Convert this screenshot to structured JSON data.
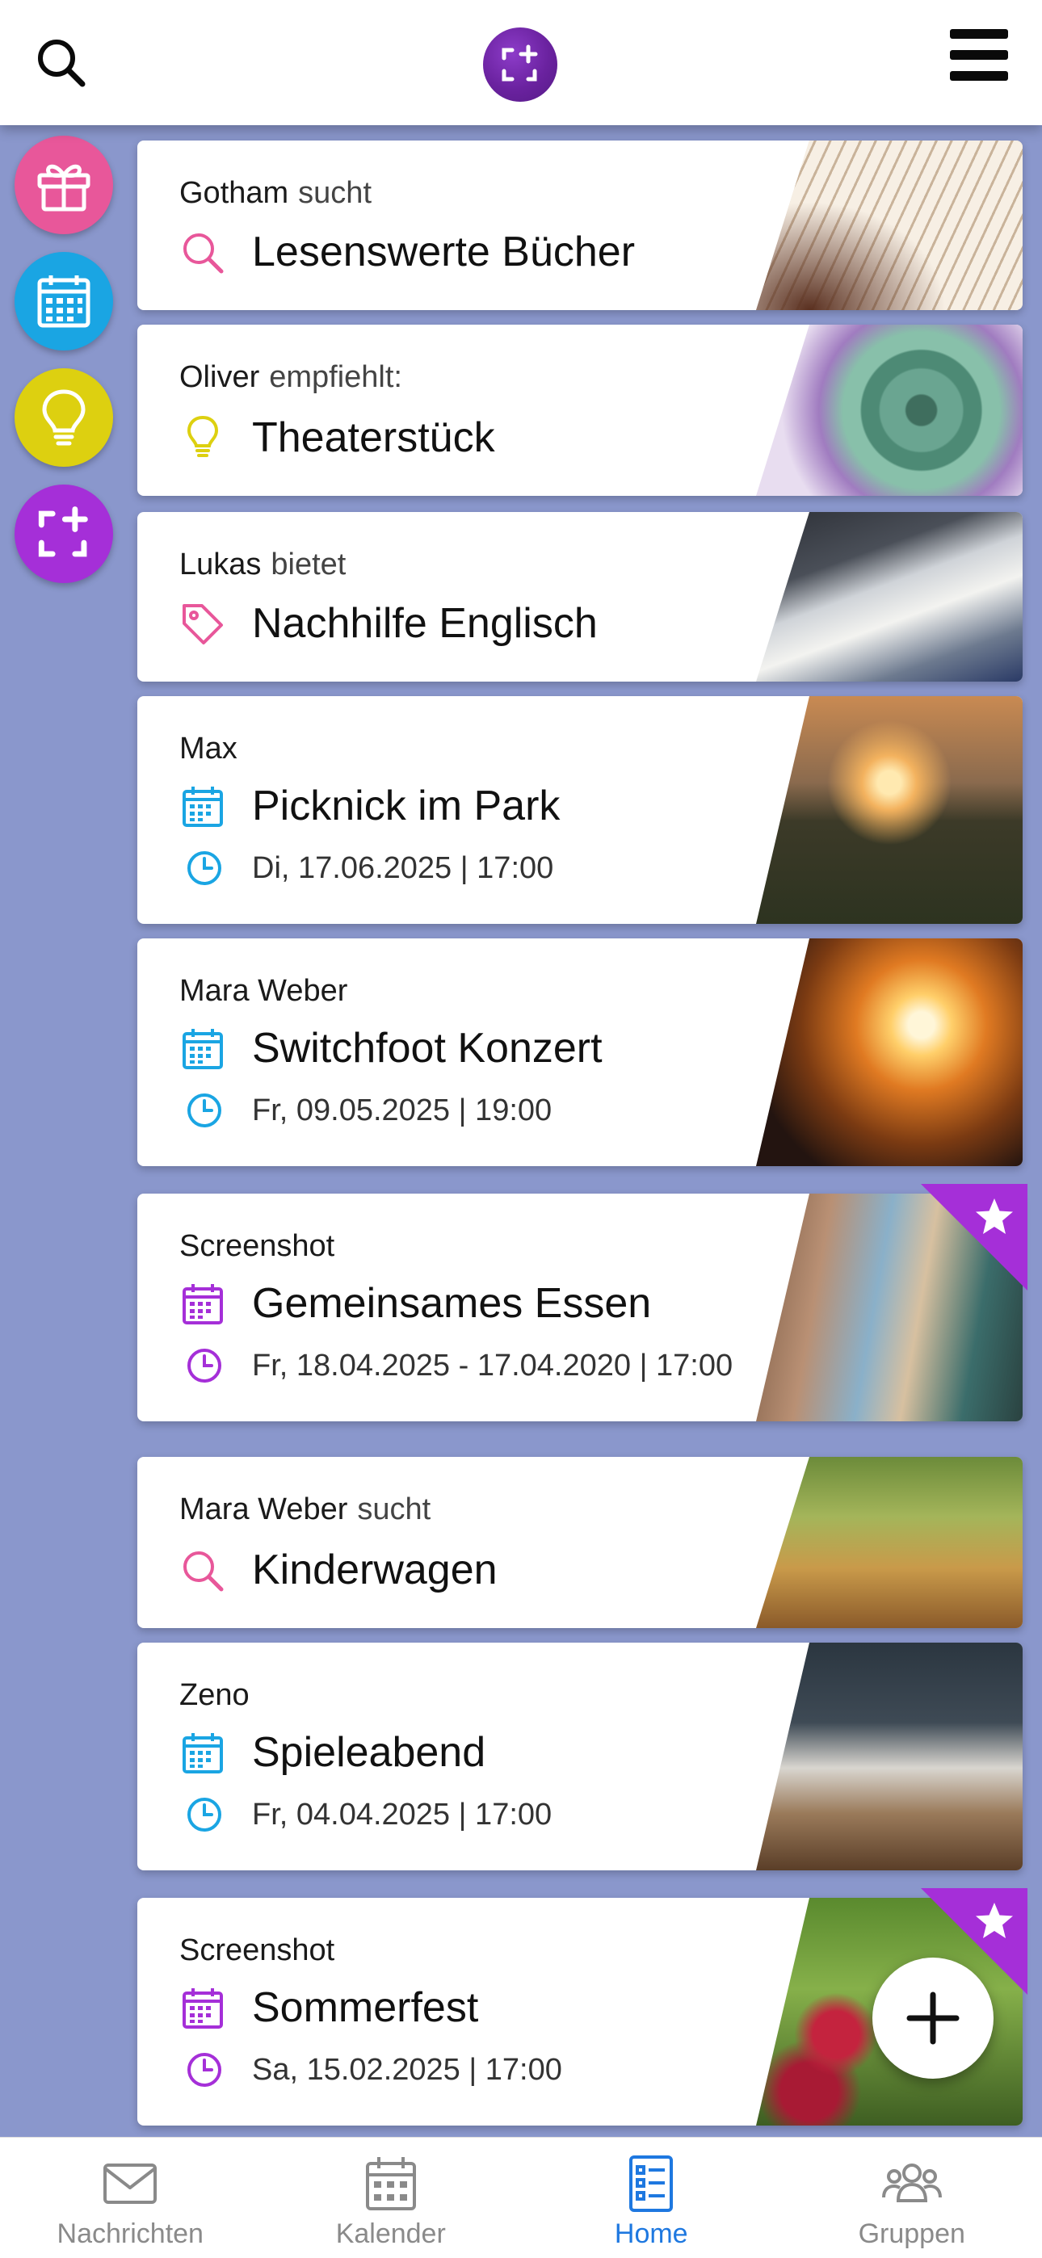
{
  "nav_bottom": [
    {
      "label": "Nachrichten",
      "icon": "envelope-icon",
      "active": false
    },
    {
      "label": "Kalender",
      "icon": "calendar-icon",
      "active": false
    },
    {
      "label": "Home",
      "icon": "list-document-icon",
      "active": true
    },
    {
      "label": "Gruppen",
      "icon": "people-group-icon",
      "active": false
    }
  ],
  "rail": [
    {
      "icon": "gift-icon",
      "color": "#e8579a"
    },
    {
      "icon": "calendar-icon",
      "color": "#1aa5e3"
    },
    {
      "icon": "lightbulb-icon",
      "color": "#ddd010"
    },
    {
      "icon": "square-plus-icon",
      "color": "#a52fd8"
    }
  ],
  "cards": [
    {
      "author": "Gotham",
      "verb": "sucht",
      "title": "Lesenswerte Bücher",
      "icon": "search-icon",
      "image": "open-book-photo"
    },
    {
      "author": "Oliver",
      "verb": "empfiehlt:",
      "title": "Theaterstück",
      "icon": "lightbulb-icon",
      "image": "succulent-photo"
    },
    {
      "author": "Lukas",
      "verb": "bietet",
      "title": "Nachhilfe Englisch",
      "icon": "tag-icon",
      "image": "desk-notebook-photo"
    },
    {
      "author": "Max",
      "verb": "",
      "title": "Picknick im Park",
      "icon": "calendar-icon",
      "date": "Di, 17.06.2025 | 17:00",
      "image": "park-picnic-photo"
    },
    {
      "author": "Mara Weber",
      "verb": "",
      "title": "Switchfoot Konzert",
      "icon": "calendar-icon",
      "date": "Fr, 09.05.2025 | 19:00",
      "image": "concert-photo"
    },
    {
      "author": "Screenshot",
      "verb": "",
      "title": "Gemeinsames Essen",
      "icon": "calendar-icon",
      "date": "Fr, 18.04.2025 - 17.04.2020 | 17:00",
      "image": "friends-dinner-photo",
      "starred": true
    },
    {
      "author": "Mara Weber",
      "verb": "sucht",
      "title": "Kinderwagen",
      "icon": "search-icon",
      "image": "family-walk-photo"
    },
    {
      "author": "Zeno",
      "verb": "",
      "title": "Spieleabend",
      "icon": "calendar-icon",
      "date": "Fr, 04.04.2025 | 17:00",
      "image": "chess-game-photo"
    },
    {
      "author": "Screenshot",
      "verb": "",
      "title": "Sommerfest",
      "icon": "calendar-icon",
      "date": "Sa, 15.02.2025 | 17:00",
      "image": "berries-photo",
      "starred": true
    }
  ],
  "colors": {
    "background": "#8a97cc",
    "pink": "#e8579a",
    "blue": "#1aa5e3",
    "yellow": "#ddd010",
    "purple": "#a52fd8",
    "active_nav": "#1e78e0"
  }
}
